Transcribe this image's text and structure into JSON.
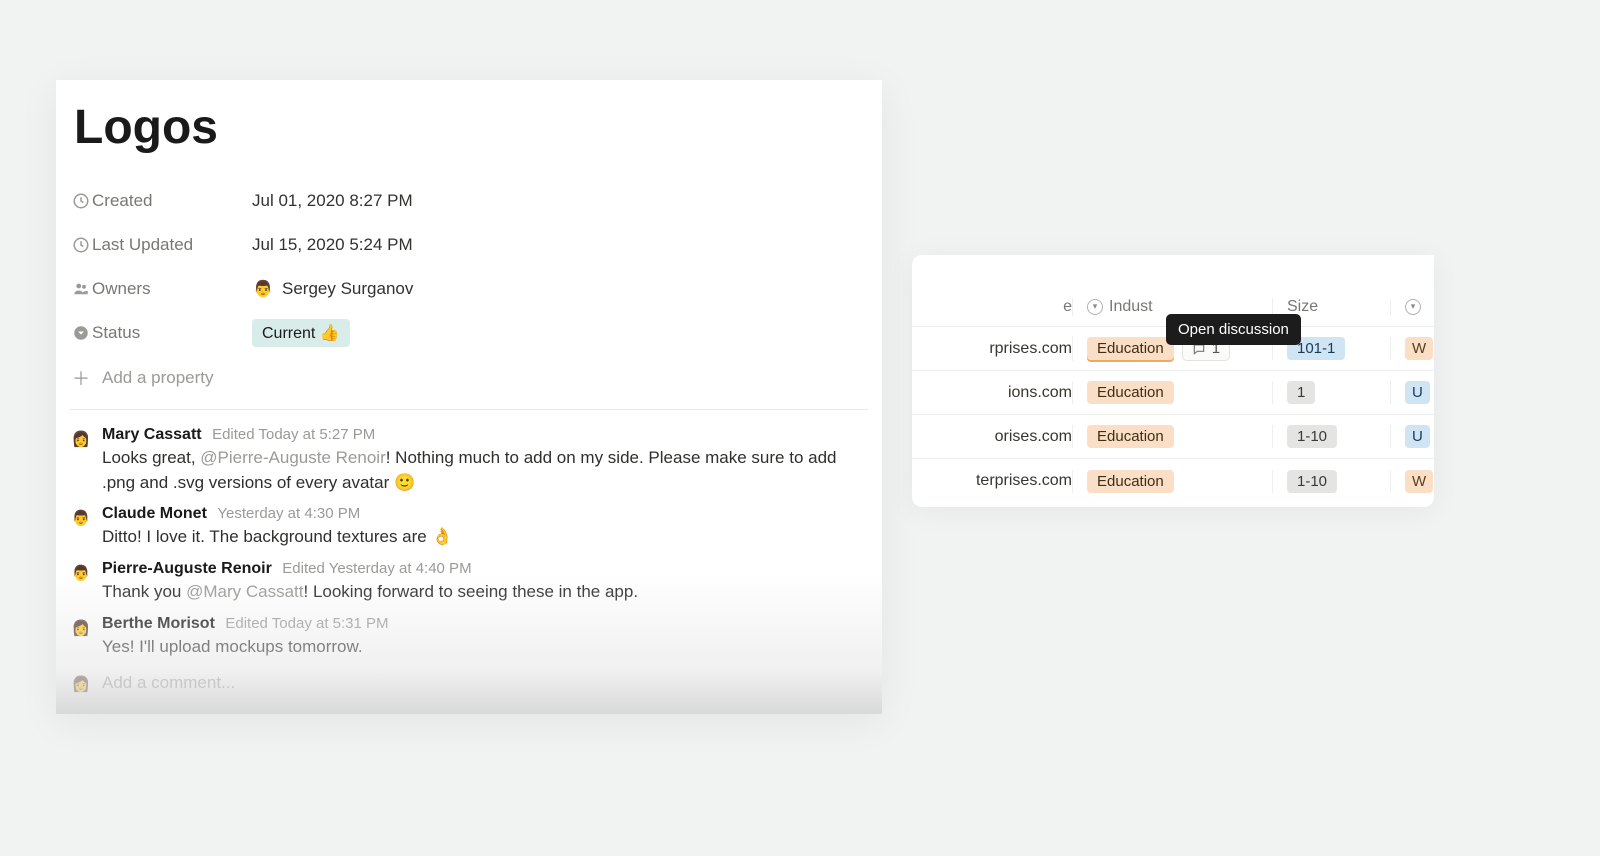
{
  "page": {
    "title": "Logos",
    "properties": [
      {
        "icon": "clock-icon",
        "label": "Created",
        "value": "Jul 01, 2020 8:27 PM"
      },
      {
        "icon": "clock-icon",
        "label": "Last Updated",
        "value": "Jul 15, 2020 5:24 PM"
      },
      {
        "icon": "people-icon",
        "label": "Owners",
        "value": "Sergey Surganov",
        "avatar": "👨"
      },
      {
        "icon": "status-icon",
        "label": "Status",
        "value": "Current 👍",
        "pill": true
      }
    ],
    "add_property_label": "Add a property",
    "comments": [
      {
        "author": "Mary Cassatt",
        "avatar": "👩",
        "meta": "Edited Today at 5:27 PM",
        "text_before": "Looks great, ",
        "mention": "@Pierre-Auguste Renoir",
        "text_after": "! Nothing much to add on my side. Please make sure to add .png and .svg versions of every avatar 🙂"
      },
      {
        "author": "Claude Monet",
        "avatar": "👨",
        "meta": "Yesterday at 4:30 PM",
        "text_before": "Ditto! I love it. The background textures are 👌",
        "mention": "",
        "text_after": ""
      },
      {
        "author": "Pierre-Auguste Renoir",
        "avatar": "👨",
        "meta": "Edited Yesterday at 4:40 PM",
        "text_before": "Thank you ",
        "mention": "@Mary Cassatt",
        "text_after": "! Looking forward to seeing these in the app."
      },
      {
        "author": "Berthe Morisot",
        "avatar": "👩",
        "meta": "Edited Today at 5:31 PM",
        "text_before": "Yes! I'll upload mockups tomorrow.",
        "mention": "",
        "text_after": ""
      }
    ],
    "add_comment_placeholder": "Add a comment...",
    "add_comment_avatar": "👩"
  },
  "tooltip": "Open discussion",
  "table": {
    "headers": {
      "col1_suffix": "e",
      "industry": "Indust",
      "size": "Size"
    },
    "discussion_count": "1",
    "rows": [
      {
        "site": "rprises.com",
        "industry": "Education",
        "ind_selected": true,
        "size": "101-1",
        "size_class": "tag-size-blue",
        "letter": "W",
        "letter_class": "tag-letter-w",
        "show_disc": true
      },
      {
        "site": "ions.com",
        "industry": "Education",
        "ind_selected": false,
        "size": "1",
        "size_class": "tag-size-grey",
        "letter": "U",
        "letter_class": "tag-letter-u",
        "show_disc": false
      },
      {
        "site": "orises.com",
        "industry": "Education",
        "ind_selected": false,
        "size": "1-10",
        "size_class": "tag-size-grey",
        "letter": "U",
        "letter_class": "tag-letter-u",
        "show_disc": false
      },
      {
        "site": "terprises.com",
        "industry": "Education",
        "ind_selected": false,
        "size": "1-10",
        "size_class": "tag-size-grey",
        "letter": "W",
        "letter_class": "tag-letter-w",
        "show_disc": false
      }
    ]
  }
}
